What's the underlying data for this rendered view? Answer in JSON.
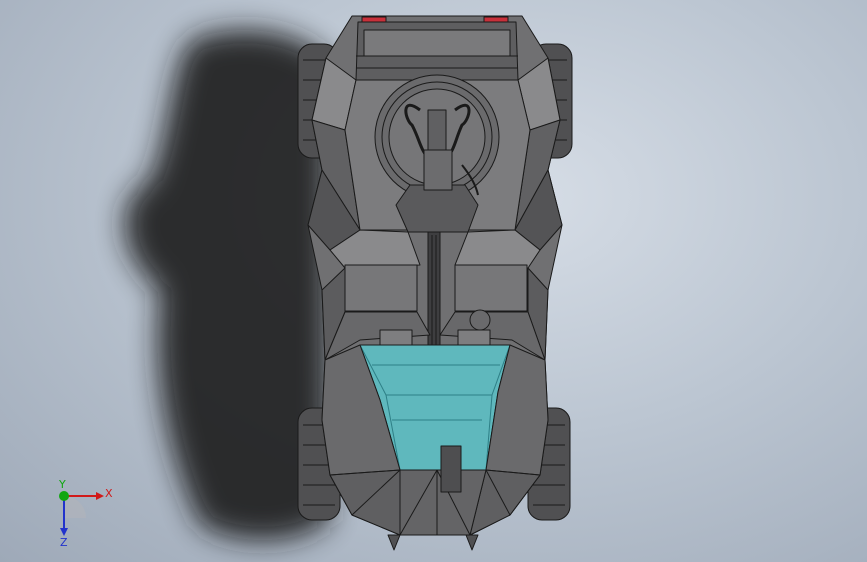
{
  "viewport": {
    "background_top": "#d6dde6",
    "background_bottom": "#9ea9b8"
  },
  "model": {
    "body_color": "#6e6e70",
    "body_dark": "#4a4a4c",
    "edge_color": "#1a1a1a",
    "canopy_color": "#5fb8bd",
    "taillight_color": "#c8303a"
  },
  "triad": {
    "x_label": "X",
    "y_label": "Y",
    "z_label": "Z",
    "x_color": "#d11919",
    "y_color": "#11a611",
    "z_color": "#2233cc"
  }
}
